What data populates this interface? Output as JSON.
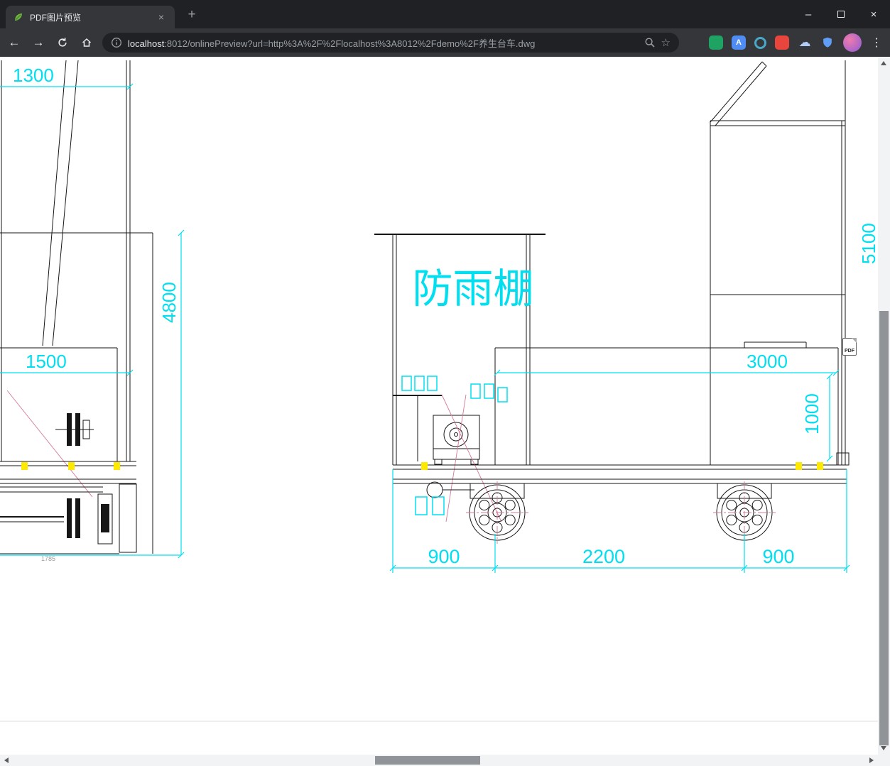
{
  "colors": {
    "accent_cyan": "#00dff0",
    "draw_line": "#161616",
    "highlight_yellow": "#ffe900",
    "construction_pink": "#d4789c",
    "chrome_dark": "#202124",
    "chrome_toolbar": "#35363a",
    "chrome_text": "#e8eaed",
    "chrome_muted": "#9aa0a6",
    "scroll_track": "#f2f3f5",
    "scroll_thumb": "#909398",
    "ext_green": "#1ea362",
    "ext_translate": "#4f8df5",
    "ext_ring": "#49a8c8",
    "ext_red": "#e8453c",
    "ext_cloud": "#aecbfa",
    "ext_shield": "#5f9df7",
    "avatar_pink": "#ef7bae",
    "avatar_purple": "#8e5bd4"
  },
  "titlebar": {
    "tab_title": "PDF图片预览",
    "tab_close": "×",
    "new_tab": "+",
    "minimize": "–",
    "close": "×"
  },
  "toolbar": {
    "back": "←",
    "forward": "→",
    "url_host": "localhost",
    "url_rest": ":8012/onlinePreview?url=http%3A%2F%2Flocalhost%3A8012%2Fdemo%2F养生台车.dwg",
    "star": "☆",
    "menu": "⋮",
    "translate_glyph": "A",
    "cloud_glyph": "☁"
  },
  "drawing": {
    "dim_1300": "1300",
    "dim_4800": "4800",
    "dim_1500": "1500",
    "label_shelter": "防雨棚",
    "dim_5100": "5100",
    "dim_3000": "3000",
    "dim_1000": "1000",
    "dim_900_left": "900",
    "dim_2200": "2200",
    "dim_900_right": "900",
    "dim_small": "1785",
    "pdf_badge": "PDF"
  }
}
